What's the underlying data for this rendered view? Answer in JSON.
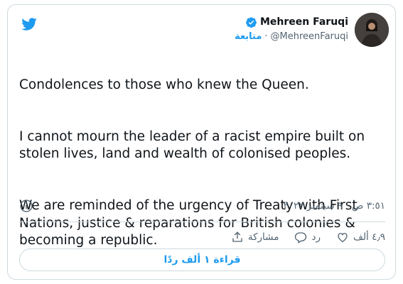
{
  "author": {
    "display_name": "Mehreen Faruqi",
    "handle": "@MehreenFaruqi",
    "follow_label": "متابعة",
    "separator": "·"
  },
  "tweet": {
    "paragraphs": [
      "Condolences to those who knew the Queen.",
      "I cannot mourn the leader of a racist empire built on stolen lives, land and wealth of colonised peoples.",
      "We are reminded of the urgency of Treaty with First Nations, justice & reparations for British colonies & becoming a republic."
    ],
    "timestamp": "٣:٥١ ص · ٩ سبتمبر ٢٠٢٢"
  },
  "actions": {
    "likes_count": "٤٫٩ ألف",
    "reply_label": "رد",
    "share_label": "مشاركة"
  },
  "read_replies_label": "قراءة ١ ألف ردًا",
  "colors": {
    "accent": "#1d9bf0",
    "text": "#0f1419",
    "muted": "#536471",
    "border": "#cfd9de"
  },
  "icons": [
    "twitter-logo-icon",
    "verified-badge-icon",
    "info-icon",
    "heart-icon",
    "reply-icon",
    "share-icon"
  ]
}
